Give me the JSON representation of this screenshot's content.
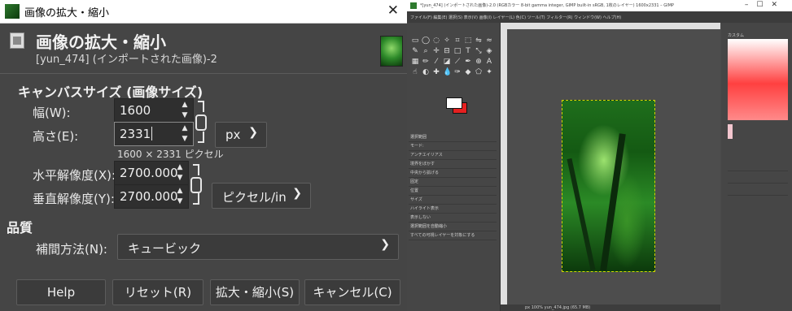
{
  "dialog": {
    "window_title": "画像の拡大・縮小",
    "header_title": "画像の拡大・縮小",
    "header_subtitle": "[yun_474] (インポートされた画像)-2",
    "canvas_section": "キャンバスサイズ (画像サイズ)",
    "width_label": "幅(W):",
    "width_value": "1600",
    "height_label": "高さ(E):",
    "height_value": "2331",
    "size_unit": "px",
    "size_info": "1600 × 2331 ピクセル",
    "xres_label": "水平解像度(X):",
    "xres_value": "2700.000",
    "yres_label": "垂直解像度(Y):",
    "yres_value": "2700.000",
    "res_unit": "ピクセル/in",
    "quality_section": "品質",
    "interp_label": "補間方法(N):",
    "interp_value": "キュービック",
    "buttons": {
      "help": "Help",
      "reset": "リセット(R)",
      "scale": "拡大・縮小(S)",
      "cancel": "キャンセル(C)"
    },
    "close_glyph": "✕"
  },
  "gimp": {
    "window_title": "*[yun_474] (インポートされた画像)-2.0 (RGBカラー 8-bit gamma integer, GIMP built-in sRGB, 1枚のレイヤー) 1600x2331 – GIMP",
    "menu": "ファイル(F) 編集(E) 選択(S) 表示(V) 画像(I) レイヤー(L) 色(C) ツール(T) フィルター(R) ウィンドウ(W) ヘルプ(H)",
    "tool_options": [
      "選択範囲",
      "モード:",
      "アンチエイリアス",
      "境界をぼかす",
      "中央から拡げる",
      "固定",
      "位置",
      "サイズ",
      "ハイライト表示",
      "表示しない",
      "選択範囲を自動縮小",
      "すべての可視レイヤーを対象にする"
    ],
    "status": "px  100%  yun_474.jpg (65.7 MB)",
    "brush_label": "カスタム"
  }
}
